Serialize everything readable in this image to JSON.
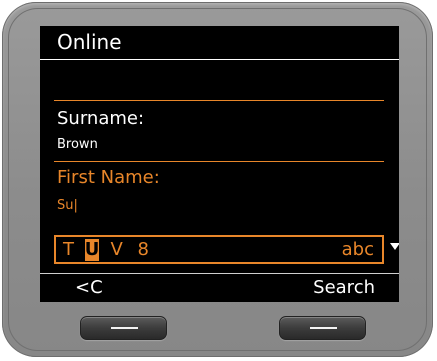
{
  "screen": {
    "title": "Online"
  },
  "form": {
    "surname_label": "Surname:",
    "surname_value": "Brown",
    "firstname_label": "First Name:",
    "firstname_value": "Su|"
  },
  "keypad_row": {
    "chars": [
      "T",
      "U",
      "V",
      "8"
    ],
    "active_index": 1,
    "mode": "abc"
  },
  "softkeys": {
    "left_label": "<C",
    "right_label": "Search"
  },
  "colors": {
    "accent": "#e8862a",
    "screen_bg": "#000000",
    "text": "#ffffff",
    "device_body": "#8f8f8f"
  },
  "icons": {
    "scroll": "triangle-down-icon",
    "hardware_key": "dash-icon"
  }
}
